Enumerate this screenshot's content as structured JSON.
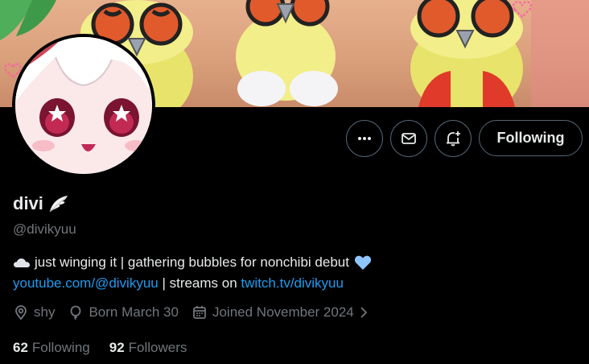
{
  "profile": {
    "display_name": "divi",
    "name_emoji_icon": "wing-emoji",
    "handle": "@divikyuu",
    "bio_line1": "just winging it | gathering bubbles for nonchibi debut",
    "bio_line1_lead_icon": "cloud-emoji",
    "bio_line1_trail_icon": "blue-heart-emoji",
    "youtube_link": "youtube.com/@divikyuu",
    "bio_mid_text": " | streams on ",
    "twitch_link": "twitch.tv/divikyuu",
    "location": "shy",
    "birthday": "Born March 30",
    "joined": "Joined November 2024"
  },
  "actions": {
    "more_icon": "more-dots-icon",
    "message_icon": "envelope-icon",
    "notify_icon": "bell-plus-icon",
    "following_label": "Following"
  },
  "stats": {
    "following_count": "62",
    "following_label": "Following",
    "followers_count": "92",
    "followers_label": "Followers"
  },
  "colors": {
    "background": "#000000",
    "text_primary": "#e7e9ea",
    "text_secondary": "#71767b",
    "link": "#1d9bf0",
    "border": "#536471",
    "heart": "#8ec5ff"
  }
}
